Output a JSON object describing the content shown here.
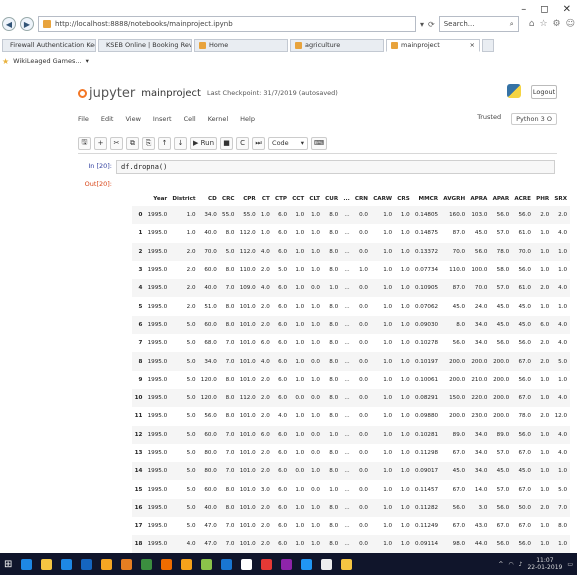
{
  "browser": {
    "window_controls": [
      "–",
      "◻",
      "✕"
    ],
    "address": "http://localhost:8888/notebooks/mainproject.ipynb",
    "search_placeholder": "Search...",
    "tabs": [
      {
        "label": "Firewall Authentication Keepali...",
        "color": "#d05a2a"
      },
      {
        "label": "KSEB Online | Booking Revu Si...",
        "color": "#1c6fb5"
      },
      {
        "label": "Home",
        "color": "#e8a33c"
      },
      {
        "label": "agriculture",
        "color": "#e8a33c"
      },
      {
        "label": "mainproject",
        "color": "#e8a33c"
      }
    ],
    "favorites_label": "WikiLeaged Games..."
  },
  "notebook": {
    "logo_text": "jupyter",
    "name": "mainproject",
    "checkpoint": "Last Checkpoint: 31/7/2019 (autosaved)",
    "logout_label": "Logout",
    "menu": [
      "File",
      "Edit",
      "View",
      "Insert",
      "Cell",
      "Kernel",
      "Help"
    ],
    "trusted_label": "Trusted",
    "kernel_label": "Python 3 O",
    "toolbar": [
      "🖫",
      "+",
      "✂",
      "⧉",
      "⎘",
      "↑",
      "↓",
      "▶ Run",
      "■",
      "C",
      "⏭"
    ],
    "cell_type": "Code"
  },
  "cell": {
    "in_prompt": "In [20]:",
    "code": "df.dropna()",
    "out_prompt": "Out[20]:"
  },
  "table": {
    "columns": [
      "",
      "Year",
      "District",
      "CD",
      "CRC",
      "CPR",
      "CT",
      "CTP",
      "CCT",
      "CLT",
      "CUR",
      "...",
      "CRN",
      "CARW",
      "CRS",
      "MMCR",
      "AVGRH",
      "APRA",
      "APAR",
      "ACRE",
      "PHR",
      "SRX"
    ],
    "rows": [
      [
        "0",
        "1995.0",
        "1.0",
        "34.0",
        "55.0",
        "55.0",
        "1.0",
        "6.0",
        "1.0",
        "1.0",
        "8.0",
        "...",
        "0.0",
        "1.0",
        "1.0",
        "0.14805",
        "160.0",
        "103.0",
        "56.0",
        "56.0",
        "2.0",
        "2.0"
      ],
      [
        "1",
        "1995.0",
        "1.0",
        "40.0",
        "8.0",
        "112.0",
        "1.0",
        "6.0",
        "1.0",
        "1.0",
        "8.0",
        "...",
        "0.0",
        "1.0",
        "1.0",
        "0.14875",
        "87.0",
        "45.0",
        "57.0",
        "61.0",
        "1.0",
        "4.0"
      ],
      [
        "2",
        "1995.0",
        "2.0",
        "70.0",
        "5.0",
        "112.0",
        "4.0",
        "6.0",
        "1.0",
        "1.0",
        "8.0",
        "...",
        "0.0",
        "1.0",
        "1.0",
        "0.13372",
        "70.0",
        "56.0",
        "78.0",
        "70.0",
        "1.0",
        "1.0"
      ],
      [
        "3",
        "1995.0",
        "2.0",
        "60.0",
        "8.0",
        "110.0",
        "2.0",
        "5.0",
        "1.0",
        "1.0",
        "8.0",
        "...",
        "1.0",
        "1.0",
        "1.0",
        "0.07734",
        "110.0",
        "100.0",
        "58.0",
        "56.0",
        "1.0",
        "1.0"
      ],
      [
        "4",
        "1995.0",
        "2.0",
        "40.0",
        "7.0",
        "109.0",
        "4.0",
        "6.0",
        "1.0",
        "0.0",
        "1.0",
        "...",
        "0.0",
        "1.0",
        "1.0",
        "0.10905",
        "87.0",
        "70.0",
        "57.0",
        "61.0",
        "2.0",
        "4.0"
      ],
      [
        "5",
        "1995.0",
        "2.0",
        "51.0",
        "8.0",
        "101.0",
        "2.0",
        "6.0",
        "1.0",
        "1.0",
        "8.0",
        "...",
        "0.0",
        "1.0",
        "1.0",
        "0.07062",
        "45.0",
        "24.0",
        "45.0",
        "45.0",
        "1.0",
        "1.0"
      ],
      [
        "6",
        "1995.0",
        "5.0",
        "60.0",
        "8.0",
        "101.0",
        "2.0",
        "6.0",
        "1.0",
        "1.0",
        "8.0",
        "...",
        "0.0",
        "1.0",
        "1.0",
        "0.09030",
        "8.0",
        "34.0",
        "45.0",
        "45.0",
        "6.0",
        "4.0"
      ],
      [
        "7",
        "1995.0",
        "5.0",
        "68.0",
        "7.0",
        "101.0",
        "6.0",
        "6.0",
        "1.0",
        "1.0",
        "8.0",
        "...",
        "0.0",
        "1.0",
        "1.0",
        "0.10278",
        "56.0",
        "34.0",
        "56.0",
        "56.0",
        "2.0",
        "4.0"
      ],
      [
        "8",
        "1995.0",
        "5.0",
        "34.0",
        "7.0",
        "101.0",
        "4.0",
        "6.0",
        "1.0",
        "0.0",
        "8.0",
        "...",
        "0.0",
        "1.0",
        "1.0",
        "0.10197",
        "200.0",
        "200.0",
        "200.0",
        "67.0",
        "2.0",
        "5.0"
      ],
      [
        "9",
        "1995.0",
        "5.0",
        "120.0",
        "8.0",
        "101.0",
        "2.0",
        "6.0",
        "1.0",
        "1.0",
        "8.0",
        "...",
        "0.0",
        "1.0",
        "1.0",
        "0.10061",
        "200.0",
        "210.0",
        "200.0",
        "56.0",
        "1.0",
        "1.0"
      ],
      [
        "10",
        "1995.0",
        "5.0",
        "120.0",
        "8.0",
        "112.0",
        "2.0",
        "6.0",
        "0.0",
        "0.0",
        "8.0",
        "...",
        "0.0",
        "1.0",
        "1.0",
        "0.08291",
        "150.0",
        "220.0",
        "200.0",
        "67.0",
        "1.0",
        "4.0"
      ],
      [
        "11",
        "1995.0",
        "5.0",
        "56.0",
        "8.0",
        "101.0",
        "2.0",
        "4.0",
        "1.0",
        "1.0",
        "8.0",
        "...",
        "0.0",
        "1.0",
        "1.0",
        "0.09880",
        "200.0",
        "230.0",
        "200.0",
        "78.0",
        "2.0",
        "12.0"
      ],
      [
        "12",
        "1995.0",
        "5.0",
        "60.0",
        "7.0",
        "101.0",
        "6.0",
        "6.0",
        "1.0",
        "0.0",
        "1.0",
        "...",
        "0.0",
        "1.0",
        "1.0",
        "0.10281",
        "89.0",
        "34.0",
        "89.0",
        "56.0",
        "1.0",
        "4.0"
      ],
      [
        "13",
        "1995.0",
        "5.0",
        "80.0",
        "7.0",
        "101.0",
        "2.0",
        "6.0",
        "1.0",
        "0.0",
        "8.0",
        "...",
        "0.0",
        "1.0",
        "1.0",
        "0.11298",
        "67.0",
        "34.0",
        "57.0",
        "67.0",
        "1.0",
        "4.0"
      ],
      [
        "14",
        "1995.0",
        "5.0",
        "80.0",
        "7.0",
        "101.0",
        "2.0",
        "6.0",
        "0.0",
        "1.0",
        "8.0",
        "...",
        "0.0",
        "1.0",
        "1.0",
        "0.09017",
        "45.0",
        "34.0",
        "45.0",
        "45.0",
        "1.0",
        "1.0"
      ],
      [
        "15",
        "1995.0",
        "5.0",
        "60.0",
        "8.0",
        "101.0",
        "3.0",
        "6.0",
        "1.0",
        "0.0",
        "1.0",
        "...",
        "0.0",
        "1.0",
        "1.0",
        "0.11457",
        "67.0",
        "14.0",
        "57.0",
        "67.0",
        "1.0",
        "5.0"
      ],
      [
        "16",
        "1995.0",
        "5.0",
        "40.0",
        "8.0",
        "101.0",
        "2.0",
        "6.0",
        "1.0",
        "1.0",
        "8.0",
        "...",
        "0.0",
        "1.0",
        "1.0",
        "0.11282",
        "56.0",
        "3.0",
        "56.0",
        "50.0",
        "2.0",
        "7.0"
      ],
      [
        "17",
        "1995.0",
        "5.0",
        "47.0",
        "7.0",
        "101.0",
        "2.0",
        "6.0",
        "1.0",
        "1.0",
        "8.0",
        "...",
        "0.0",
        "1.0",
        "1.0",
        "0.11249",
        "67.0",
        "43.0",
        "67.0",
        "67.0",
        "1.0",
        "8.0"
      ],
      [
        "18",
        "1995.0",
        "4.0",
        "47.0",
        "7.0",
        "101.0",
        "2.0",
        "6.0",
        "1.0",
        "1.0",
        "8.0",
        "...",
        "0.0",
        "1.0",
        "1.0",
        "0.09114",
        "98.0",
        "44.0",
        "56.0",
        "56.0",
        "1.0",
        "1.0"
      ]
    ]
  },
  "taskbar": {
    "apps": [
      "#1e88e5",
      "#f5c542",
      "#1e88e5",
      "#1565c0",
      "#f5a623",
      "#e67e22",
      "#3b8e3f",
      "#ef6c00",
      "#f6a21b",
      "#8bc34a",
      "#1976d2",
      "#ffffff",
      "#e53935",
      "#8e24aa",
      "#2196f3",
      "#eeeeee",
      "#f5c542"
    ],
    "time": "11:07",
    "date": "22-01-2019"
  }
}
